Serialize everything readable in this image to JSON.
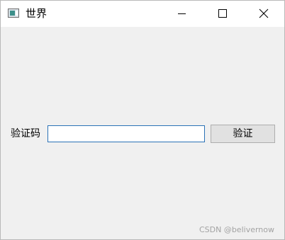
{
  "window": {
    "title": "世界",
    "icon": "window-icon"
  },
  "caption_buttons": {
    "minimize_icon": "minimize-icon",
    "maximize_icon": "maximize-icon",
    "close_icon": "close-icon"
  },
  "form": {
    "label": "验证码",
    "input_value": "",
    "button_label": "验证"
  },
  "watermark": "CSDN @belivernow",
  "colors": {
    "client_background": "#f0f0f0",
    "input_border": "#2b72b6",
    "button_background": "#e1e1e1",
    "button_border": "#adadad"
  }
}
